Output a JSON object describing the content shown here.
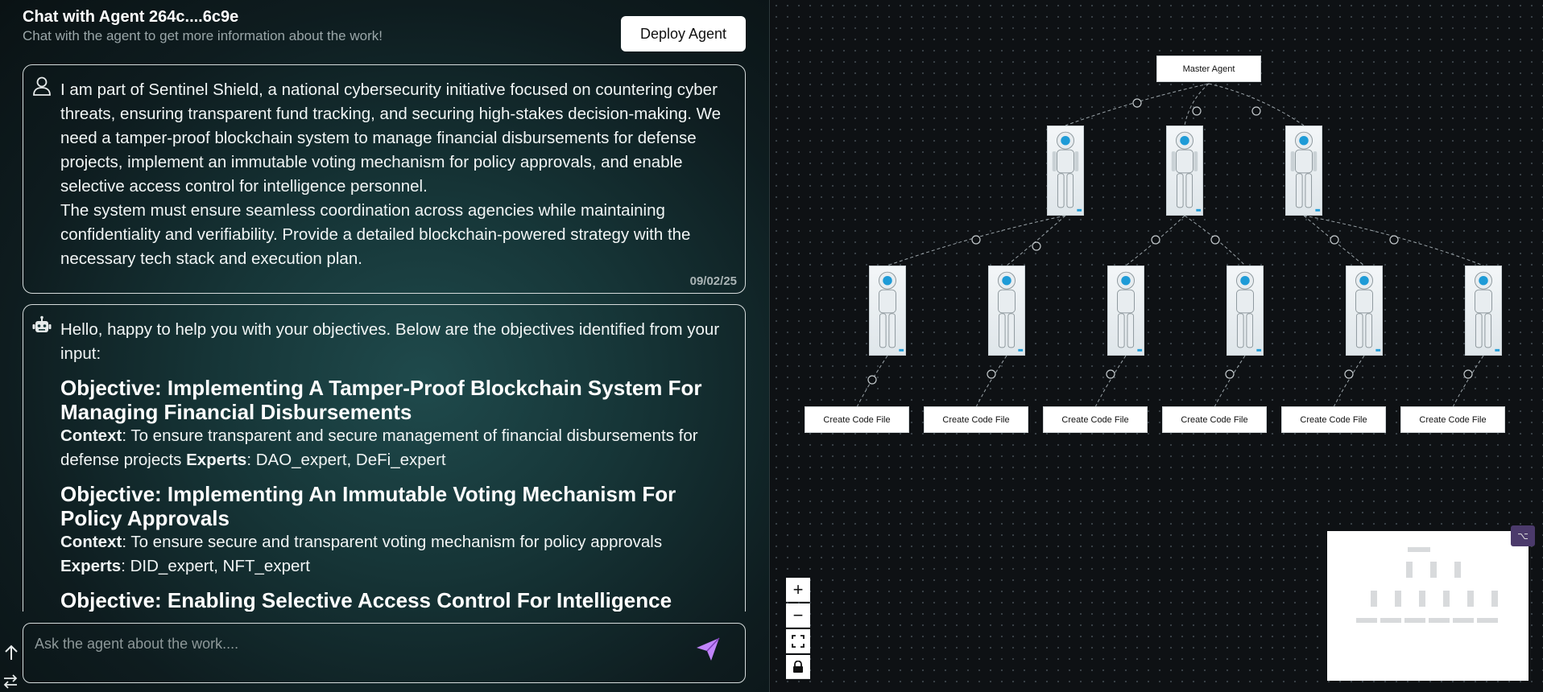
{
  "header": {
    "title": "Chat with Agent 264c....6c9e",
    "subtitle": "Chat with the agent to get more information about the work!",
    "deploy_label": "Deploy Agent"
  },
  "messages": {
    "user": {
      "icon": "user-icon",
      "para1": "I am part of Sentinel Shield, a national cybersecurity initiative focused on countering cyber threats, ensuring transparent fund tracking, and securing high-stakes decision-making. We need a tamper-proof blockchain system to manage financial disbursements for defense projects, implement an immutable voting mechanism for policy approvals, and enable selective access control for intelligence personnel.",
      "para2": "The system must ensure seamless coordination across agencies while maintaining confidentiality and verifiability. Provide a detailed blockchain-powered strategy with the necessary tech stack and execution plan.",
      "date": "09/02/25"
    },
    "bot": {
      "icon": "robot-icon",
      "intro": "Hello, happy to help you with your objectives. Below are the objectives identified from your input:",
      "objectives": [
        {
          "title": "Objective: Implementing A Tamper-Proof Blockchain System For Managing Financial Disbursements",
          "context_label": "Context",
          "context": ": To ensure transparent and secure management of financial disbursements for defense projects ",
          "experts_label": "Experts",
          "experts": ": DAO_expert, DeFi_expert"
        },
        {
          "title": "Objective: Implementing An Immutable Voting Mechanism For Policy Approvals",
          "context_label": "Context",
          "context": ": To ensure secure and transparent voting mechanism for policy approvals",
          "experts_label": "Experts",
          "experts": ": DID_expert, NFT_expert"
        },
        {
          "title": "Objective: Enabling Selective Access Control For Intelligence Personnel"
        }
      ]
    }
  },
  "input": {
    "placeholder": "Ask the agent about the work...."
  },
  "canvas": {
    "master_label": "Master Agent",
    "leaf_labels": [
      "Create Code File",
      "Create Code File",
      "Create Code File",
      "Create Code File",
      "Create Code File",
      "Create Code File"
    ],
    "zoom_in": "+",
    "zoom_out": "−",
    "minimap_toggle": "⌥"
  },
  "colors": {
    "send_icon": "#c084fc",
    "edge": "#9aa3a8",
    "robot_eye": "#1e9bd7"
  }
}
